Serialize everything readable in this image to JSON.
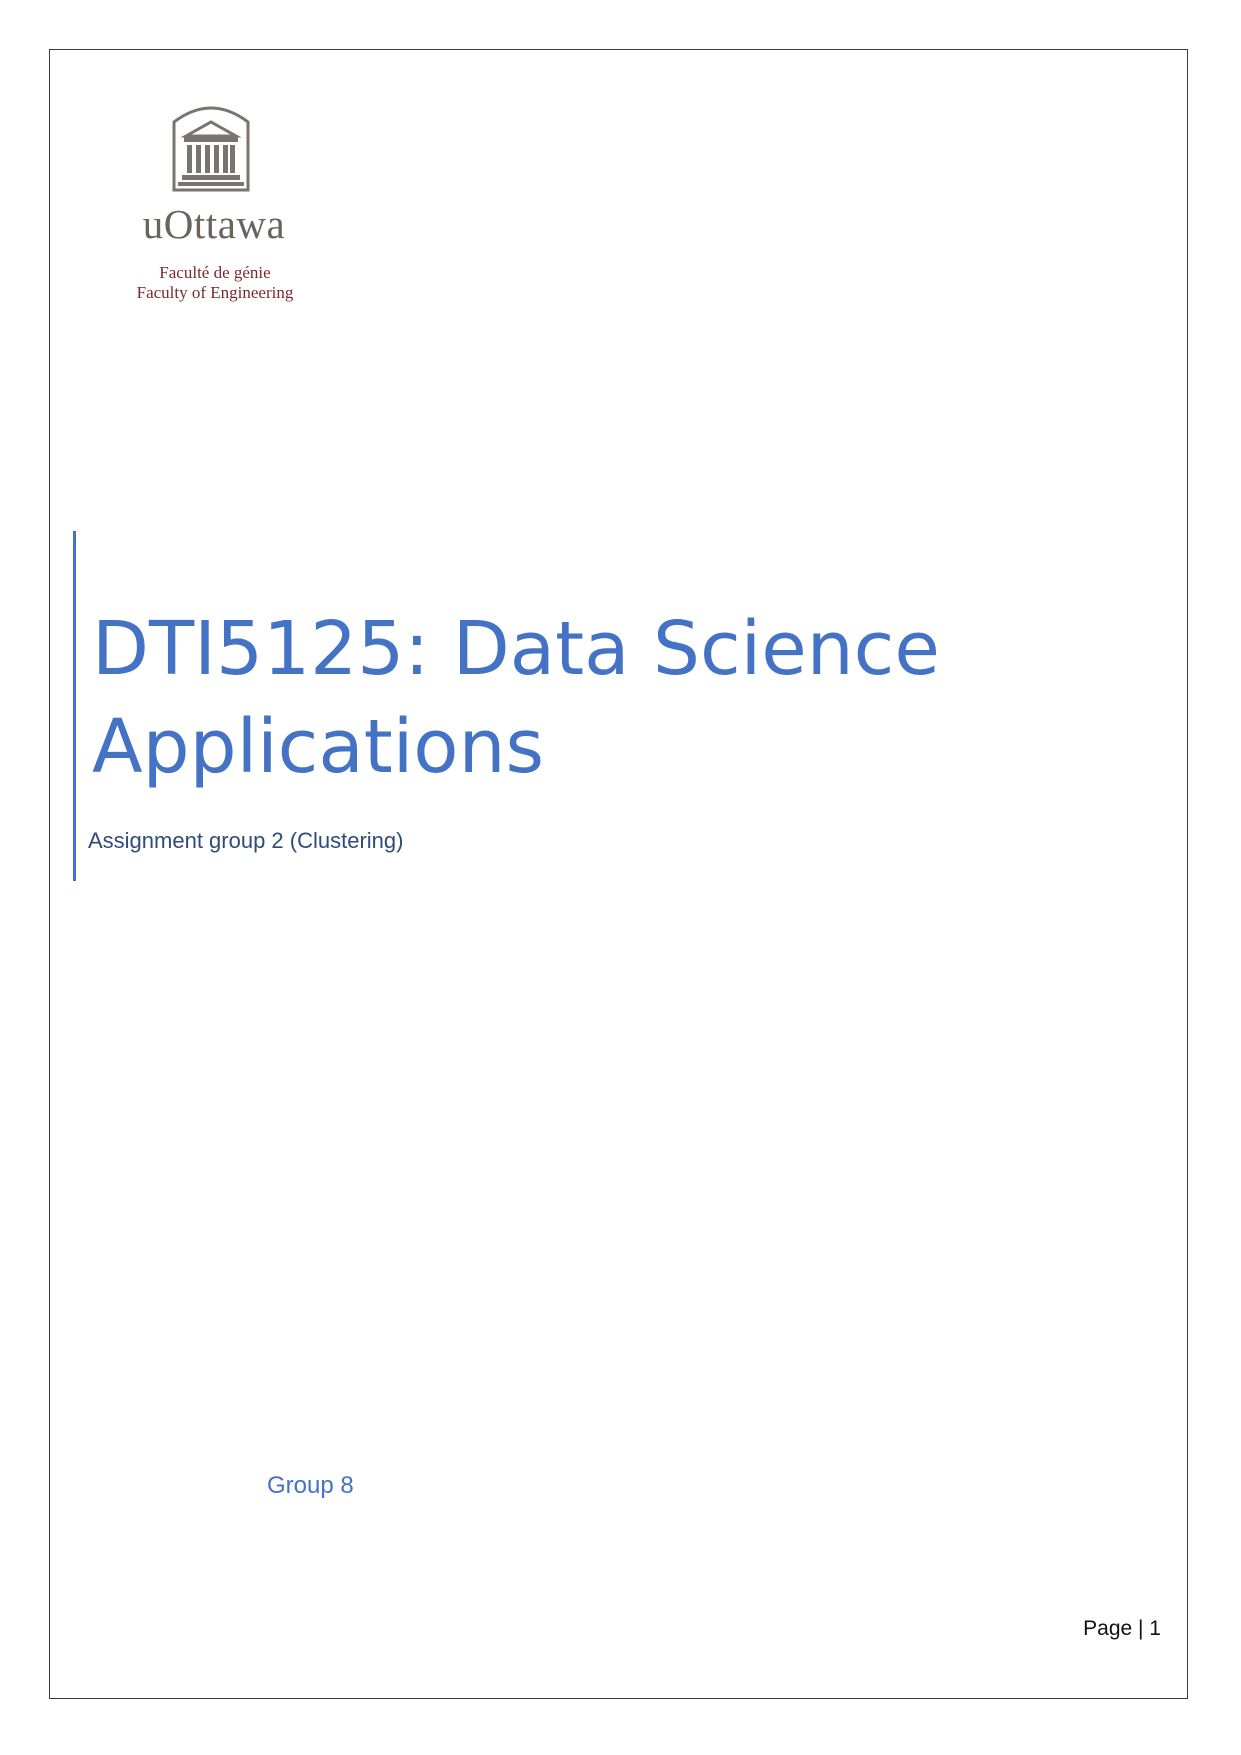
{
  "logo": {
    "icon": "university-building-icon",
    "wordmark": "uOttawa",
    "faculty_fr": "Faculté de génie",
    "faculty_en": "Faculty of Engineering",
    "colors": {
      "crest": "#7a7470",
      "faculty_text": "#7a2a2e"
    }
  },
  "cover": {
    "title": "DTI5125: Data Science Applications",
    "subtitle": "Assignment group 2 (Clustering)",
    "group": "Group 8",
    "accent_color": "#4472c4"
  },
  "footer": {
    "page_label": "Page | 1"
  }
}
